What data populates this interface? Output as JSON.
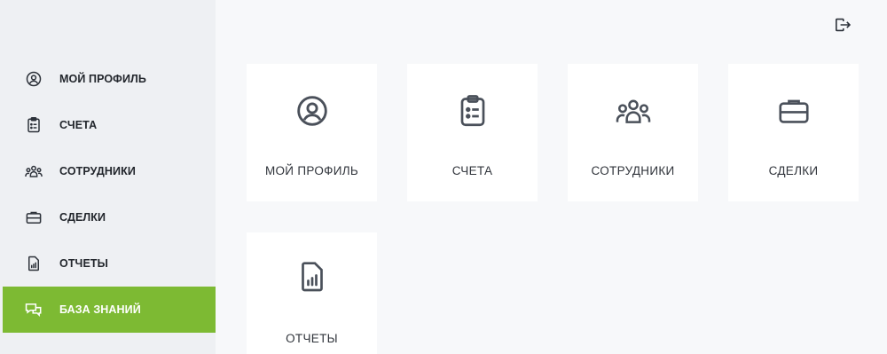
{
  "sidebar": {
    "items": [
      {
        "label": "МОЙ ПРОФИЛЬ",
        "icon": "user-circle-icon"
      },
      {
        "label": "СЧЕТА",
        "icon": "clipboard-list-icon"
      },
      {
        "label": "СОТРУДНИКИ",
        "icon": "users-group-icon"
      },
      {
        "label": "СДЕЛКИ",
        "icon": "briefcase-icon"
      },
      {
        "label": "ОТЧЕТЫ",
        "icon": "report-chart-icon"
      },
      {
        "label": "БАЗА ЗНАНИЙ",
        "icon": "chat-bubbles-icon",
        "active": true
      }
    ],
    "active_color": "#7dba33"
  },
  "header": {
    "logout_icon": "logout-icon"
  },
  "main": {
    "cards": [
      {
        "label": "МОЙ ПРОФИЛЬ",
        "icon": "user-circle-icon"
      },
      {
        "label": "СЧЕТА",
        "icon": "clipboard-list-icon"
      },
      {
        "label": "СОТРУДНИКИ",
        "icon": "users-group-icon"
      },
      {
        "label": "СДЕЛКИ",
        "icon": "briefcase-icon"
      },
      {
        "label": "ОТЧЕТЫ",
        "icon": "report-chart-icon"
      }
    ]
  }
}
